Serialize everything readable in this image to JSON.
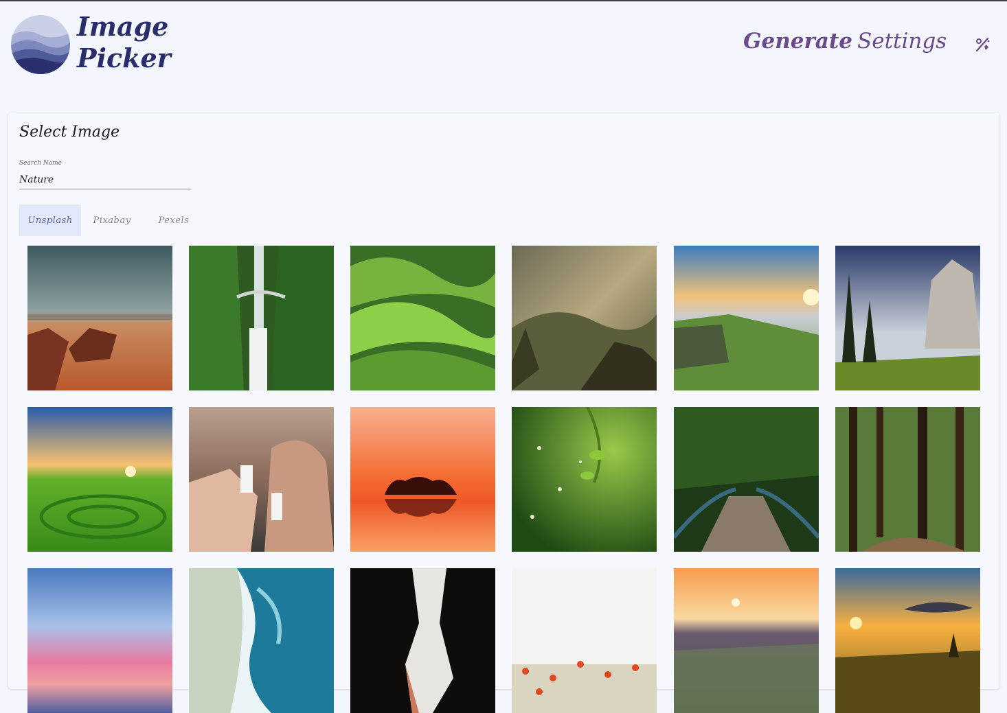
{
  "app": {
    "title_line1": "Image",
    "title_line2": "Picker"
  },
  "nav": {
    "generate": "Generate",
    "settings": "Settings",
    "theme_toggle_icon": "theme-toggle-icon"
  },
  "card": {
    "title": "Select Image",
    "search": {
      "label": "Search Name",
      "value": "Nature"
    },
    "tabs": [
      "Unsplash",
      "Pixabay",
      "Pexels"
    ],
    "active_tab": "Unsplash"
  },
  "images": [
    "desert-canyon-sunset",
    "waterfall-bridge-forest",
    "green-rolling-hills",
    "misty-mountain-valley",
    "clouds-over-green-cliffs",
    "granite-cliff-pine-forest",
    "green-valley-sunrise-spiral",
    "people-with-cartons-canyon",
    "island-trees-orange-sunset",
    "green-leaves-bokeh",
    "forest-footbridge",
    "redwood-forest-path",
    "pink-blue-sky-sea",
    "ocean-waves-aerial",
    "dark-cave-opening",
    "poppy-field-white-sky",
    "grass-sunset-field",
    "golden-field-sunset-clouds"
  ],
  "colors": {
    "background": "#f3f6fd",
    "logo_text": "#2a2d6b",
    "nav_text": "#6a4a8c",
    "active_tab_bg": "#e1e9fb"
  }
}
